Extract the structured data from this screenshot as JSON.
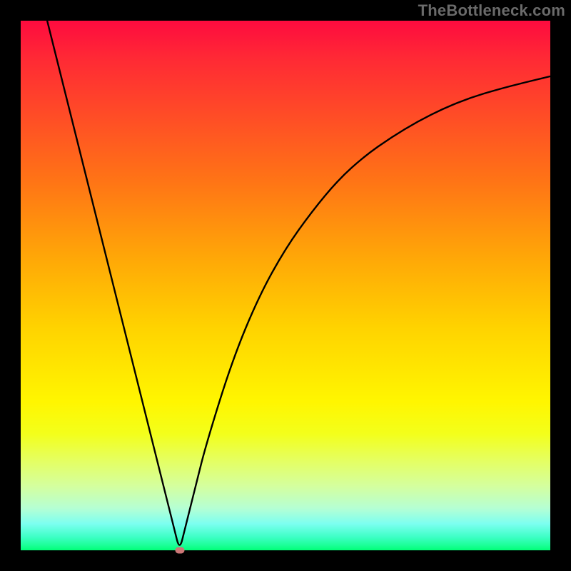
{
  "watermark": "TheBottleneck.com",
  "chart_data": {
    "type": "line",
    "title": "",
    "xlabel": "",
    "ylabel": "",
    "xlim": [
      0,
      100
    ],
    "ylim": [
      0,
      100
    ],
    "series": [
      {
        "name": "bottleneck-curve",
        "x": [
          5,
          10,
          15,
          20,
          25,
          27,
          29,
          30,
          31,
          33,
          35,
          40,
          45,
          50,
          55,
          60,
          65,
          70,
          75,
          80,
          85,
          90,
          95,
          100
        ],
        "values": [
          100,
          80,
          60,
          40,
          20,
          12,
          4,
          0,
          4,
          12,
          20,
          36,
          48,
          57,
          64,
          70,
          74.5,
          78,
          81,
          83.5,
          85.5,
          87,
          88.3,
          89.5
        ]
      }
    ],
    "marker": {
      "x": 30,
      "y": 0,
      "name": "optimal-point"
    },
    "background_gradient": {
      "top": "#fe0b3f",
      "middle": "#ffd300",
      "bottom": "#00ff78"
    }
  },
  "colors": {
    "frame": "#000000",
    "curve": "#000000",
    "marker": "#cc7777",
    "watermark": "#6a6a6a"
  }
}
